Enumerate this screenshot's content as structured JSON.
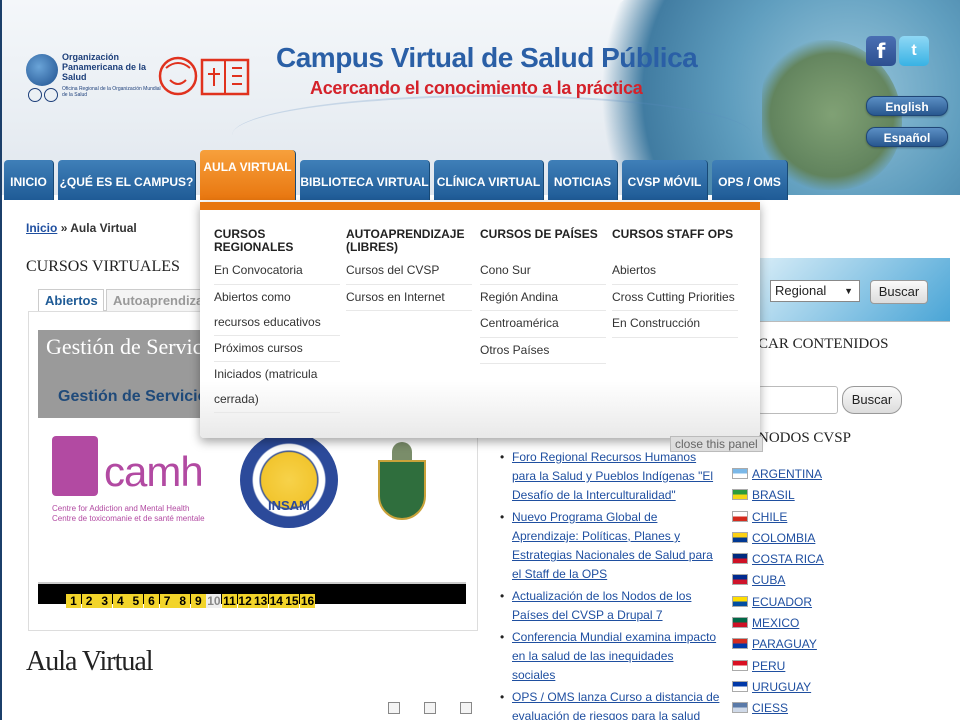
{
  "header": {
    "org_name": "Organización Panamericana de la Salud",
    "org_sub": "Oficina Regional de la Organización Mundial de la Salud",
    "site_title": "Campus Virtual de Salud Pública",
    "site_subtitle": "Acercando el conocimiento a la práctica",
    "social_fb": "f",
    "social_tw": "t",
    "lang_en": "English",
    "lang_es": "Español"
  },
  "nav": {
    "items": [
      {
        "label": "INICIO"
      },
      {
        "label": "¿QUÉ ES EL CAMPUS?"
      },
      {
        "label": "AULA VIRTUAL"
      },
      {
        "label": "BIBLIOTECA VIRTUAL"
      },
      {
        "label": "CLÍNICA VIRTUAL"
      },
      {
        "label": "NOTICIAS"
      },
      {
        "label": "CVSP MÓVIL"
      },
      {
        "label": "OPS / OMS"
      }
    ]
  },
  "mega_menu": {
    "columns": [
      {
        "heading": "CURSOS REGIONALES",
        "links": [
          "En Convocatoria",
          "Abiertos como recursos educativos",
          "Próximos cursos",
          "Iniciados (matricula cerrada)"
        ]
      },
      {
        "heading": "AUTOAPRENDIZAJE (LIBRES)",
        "links": [
          "Cursos del CVSP",
          "Cursos en Internet"
        ]
      },
      {
        "heading": "CURSOS DE PAÍSES",
        "links": [
          "Cono Sur",
          "Región Andina",
          "Centroamérica",
          "Otros Países"
        ]
      },
      {
        "heading": "CURSOS STAFF OPS",
        "links": [
          "Abiertos",
          "Cross Cutting Priorities",
          "En Construcción"
        ]
      }
    ],
    "close_label": "close this panel"
  },
  "breadcrumb": {
    "home": "Inicio",
    "sep": "»",
    "current": "Aula Virtual"
  },
  "main": {
    "section_title": "CURSOS VIRTUALES",
    "tab_active": "Abiertos",
    "tab_inactive": "Autoaprendiza",
    "slide_title": "Gestión de Servicios",
    "slide_sub": "Gestión de Servicios",
    "camh_text": "camh",
    "camh_sub1": "Centre for Addiction and Mental Health",
    "camh_sub2": "Centre de toxicomanie et de santé mentale",
    "insam_label": "INSAM",
    "pager": [
      "1",
      "2",
      "3",
      "4",
      "5",
      "6",
      "7",
      "8",
      "9",
      "10",
      "11",
      "12",
      "13",
      "14",
      "15",
      "16"
    ],
    "pager_current": "10",
    "page_heading": "Aula Virtual"
  },
  "news": {
    "items": [
      "Foro Regional Recursos Humanos para la Salud y Pueblos Indígenas \"El Desafío de la Interculturalidad\"",
      "Nuevo Programa Global de Aprendizaje: Políticas, Planes y Estrategias Nacionales de Salud para el Staff de la OPS",
      "Actualización de los Nodos de los Países del CVSP a Drupal 7",
      "Conferencia Mundial examina impacto en la salud de las inequidades sociales",
      "OPS / OMS lanza Curso a distancia de evaluación de riesgos para la salud humana por la exposición a productos"
    ]
  },
  "right": {
    "region_value": "Regional",
    "buscar_btn": "Buscar",
    "search_title": "CAR CONTENIDOS",
    "search_btn": "Buscar",
    "nodes_title": "NODOS CVSP",
    "countries": [
      {
        "name": "ARGENTINA",
        "c1": "#7bb8e8",
        "c2": "#ffffff"
      },
      {
        "name": "BRASIL",
        "c1": "#2c9a3c",
        "c2": "#f6d615"
      },
      {
        "name": "CHILE",
        "c1": "#ffffff",
        "c2": "#d52b1e"
      },
      {
        "name": "COLOMBIA",
        "c1": "#fcd116",
        "c2": "#003893"
      },
      {
        "name": "COSTA RICA",
        "c1": "#002b7f",
        "c2": "#ce1126"
      },
      {
        "name": "CUBA",
        "c1": "#002a8f",
        "c2": "#cf142b"
      },
      {
        "name": "ECUADOR",
        "c1": "#ffdd00",
        "c2": "#034ea2"
      },
      {
        "name": "MEXICO",
        "c1": "#006847",
        "c2": "#ce1126"
      },
      {
        "name": "PARAGUAY",
        "c1": "#d52b1e",
        "c2": "#0038a8"
      },
      {
        "name": "PERU",
        "c1": "#d91023",
        "c2": "#ffffff"
      },
      {
        "name": "URUGUAY",
        "c1": "#0038a8",
        "c2": "#ffffff"
      },
      {
        "name": "CIESS",
        "c1": "#5a7aa8",
        "c2": "#cfd9e8"
      }
    ]
  }
}
